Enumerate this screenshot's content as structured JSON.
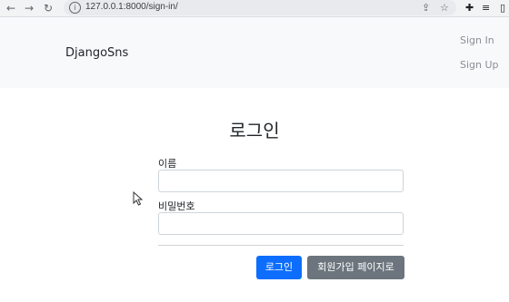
{
  "browser": {
    "url": "127.0.0.1:8000/sign-in/",
    "back_icon": "arrow-left",
    "forward_icon": "arrow-right",
    "reload_icon": "reload",
    "info_icon": "info"
  },
  "navbar": {
    "brand": "DjangoSns",
    "links": [
      "Sign In",
      "Sign Up"
    ]
  },
  "form": {
    "title": "로그인",
    "name_label": "이름",
    "name_value": "",
    "password_label": "비밀번호",
    "password_value": "",
    "login_button": "로그인",
    "signup_button": "회원가입 페이지로"
  },
  "colors": {
    "primary": "#0d6efd",
    "secondary": "#6c757d",
    "navbar_bg": "#f8f9fa"
  }
}
